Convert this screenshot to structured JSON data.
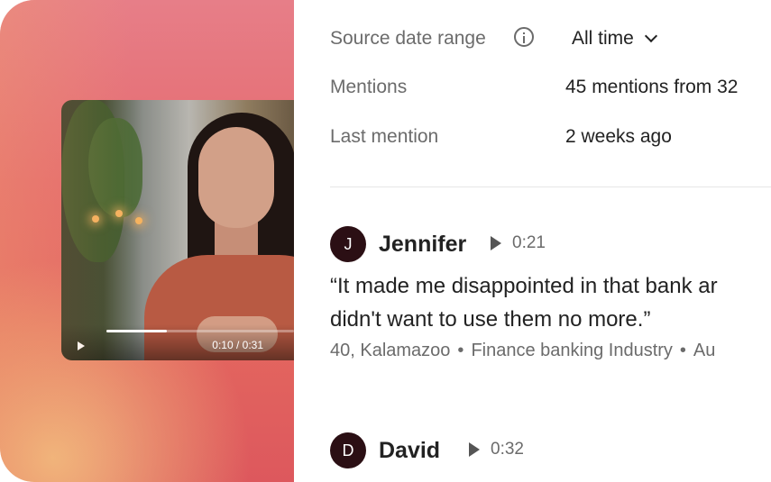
{
  "video": {
    "time": "0:10 / 0:31",
    "progress": 0.32
  },
  "meta": {
    "date_range_label": "Source date range",
    "date_range_value": "All time",
    "mentions_label": "Mentions",
    "mentions_value": "45 mentions from 32",
    "last_label": "Last mention",
    "last_value": "2 weeks ago"
  },
  "mentions": [
    {
      "initial": "J",
      "name": "Jennifer",
      "clip_time": "0:21",
      "quote_line1": "“It made me disappointed in that bank ar",
      "quote_line2": "didn't want to use them no more.”",
      "detail_age_location": "40, Kalamazoo",
      "detail_industry": "Finance banking Industry",
      "detail_more": "Au"
    },
    {
      "initial": "D",
      "name": "David",
      "clip_time": "0:32"
    }
  ],
  "colors": {
    "avatar": "#2b0f14",
    "gradient_top": "#e77e88",
    "gradient_bottom": "#dd585d"
  }
}
